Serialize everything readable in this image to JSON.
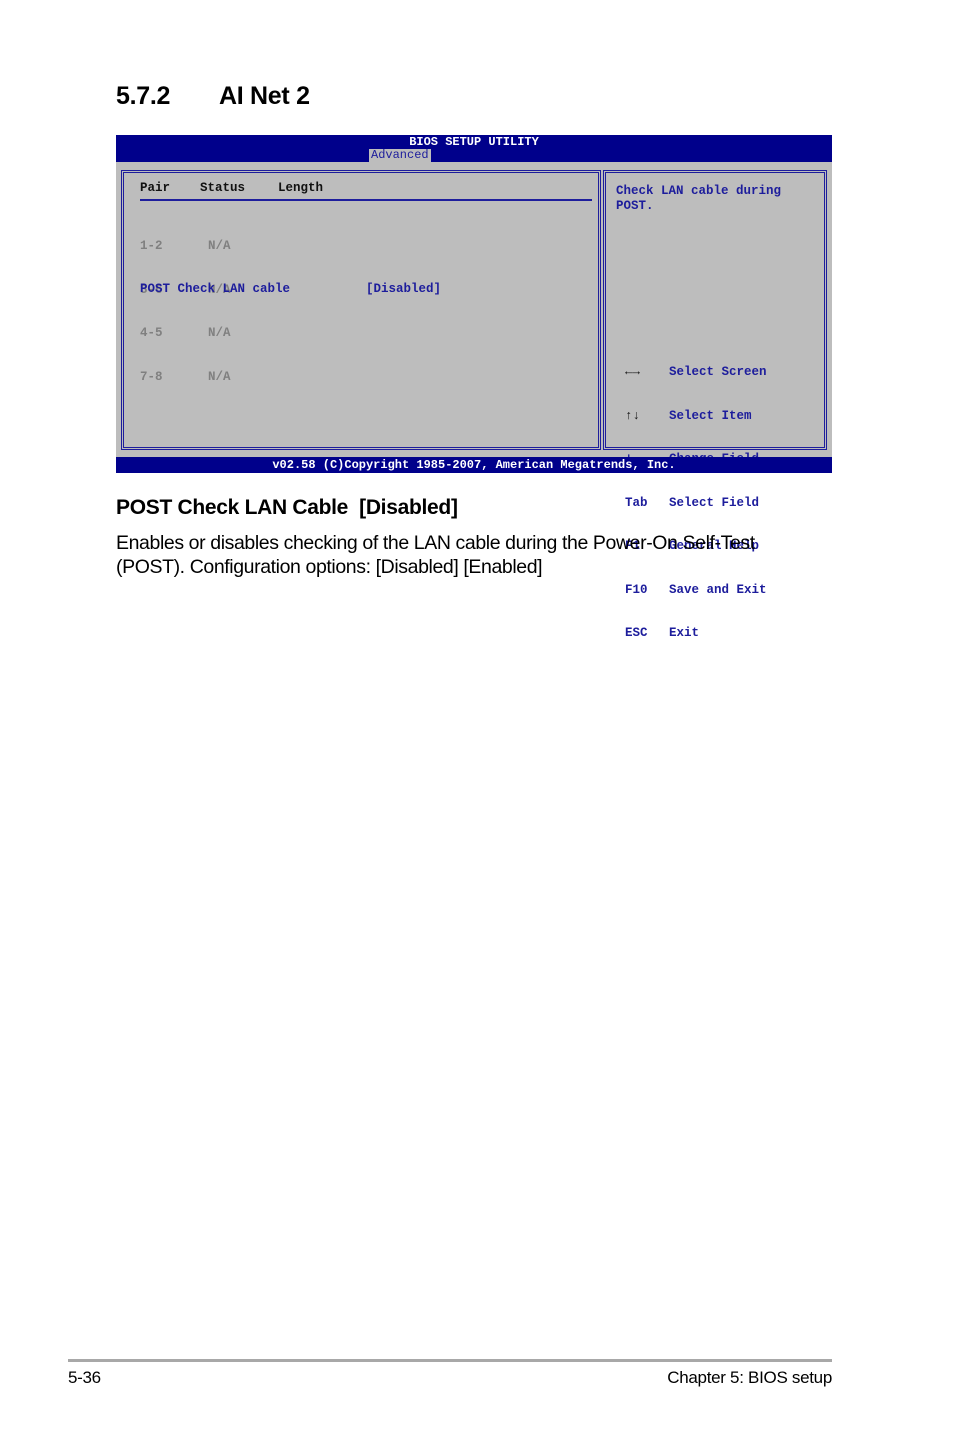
{
  "section": {
    "number": "5.7.2",
    "title": "AI Net 2"
  },
  "bios": {
    "title": "BIOS SETUP UTILITY",
    "active_tab": "Advanced",
    "table_headers": [
      "Pair",
      "Status",
      "Length"
    ],
    "pairs": [
      {
        "pair": "1-2",
        "status": "N/A"
      },
      {
        "pair": "3-6",
        "status": "N/A"
      },
      {
        "pair": "4-5",
        "status": "N/A"
      },
      {
        "pair": "7-8",
        "status": "N/A"
      }
    ],
    "setting": {
      "label": "POST Check LAN cable",
      "value": "[Disabled]"
    },
    "help_text": [
      "Check LAN cable during",
      "POST."
    ],
    "keys": [
      {
        "key": "←→",
        "icon": "left-right-arrows-icon",
        "action": "Select Screen"
      },
      {
        "key": "↑↓",
        "icon": "up-down-arrows-icon",
        "action": "Select Item"
      },
      {
        "key": "+-",
        "action": "Change Field"
      },
      {
        "key": "Tab",
        "action": "Select Field"
      },
      {
        "key": "F1",
        "action": "General Help"
      },
      {
        "key": "F10",
        "action": "Save and Exit"
      },
      {
        "key": "ESC",
        "action": "Exit"
      }
    ],
    "copyright": "v02.58 (C)Copyright 1985-2007, American Megatrends, Inc."
  },
  "option": {
    "title": "POST Check LAN Cable  [Disabled]",
    "description_line1": "Enables or disables checking of the LAN cable during the Power-On Self-Test",
    "description_line2": "(POST). Configuration options: [Disabled] [Enabled]"
  },
  "footer": {
    "page": "5-36",
    "chapter": "Chapter 5: BIOS setup"
  }
}
